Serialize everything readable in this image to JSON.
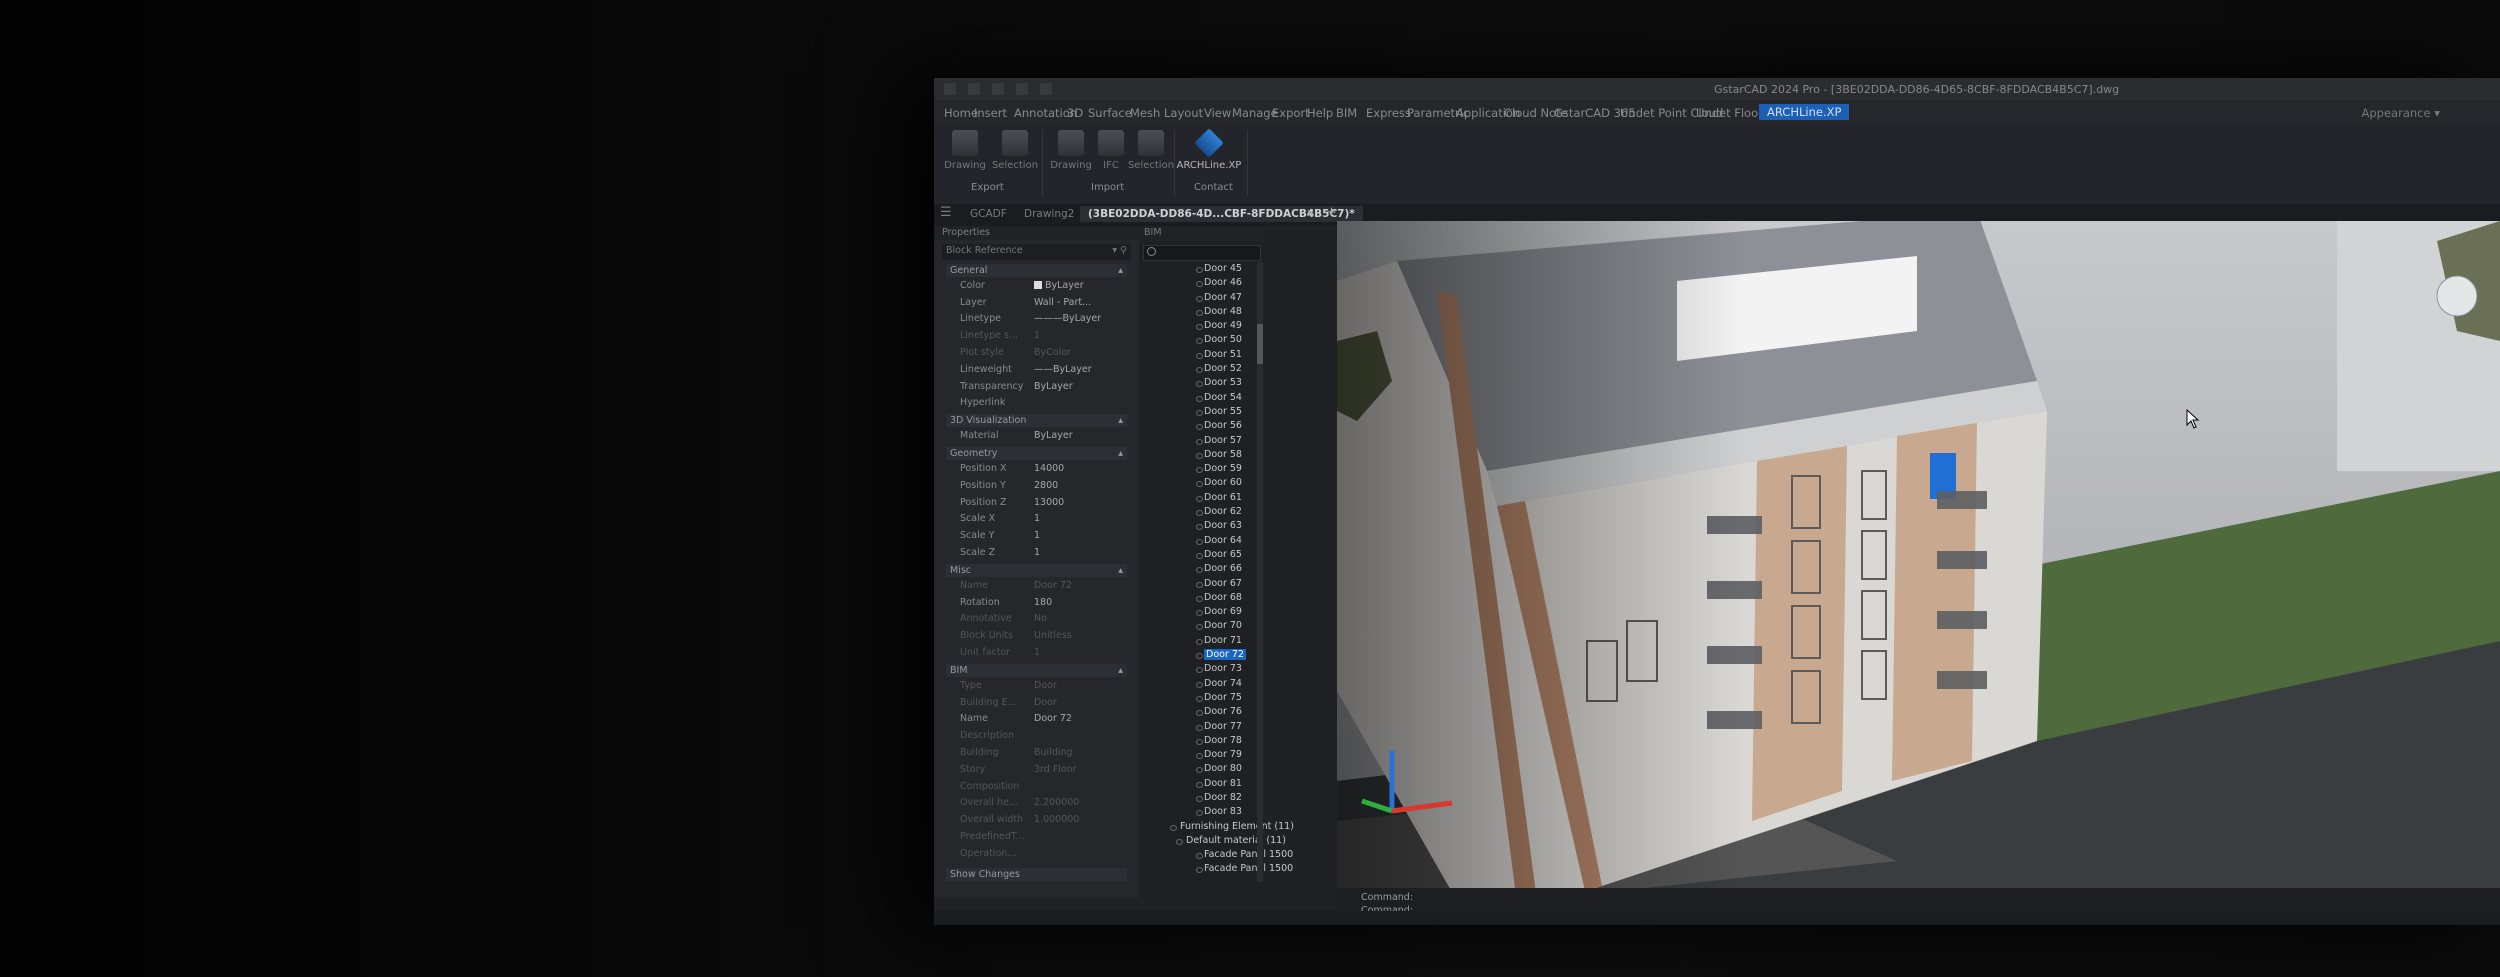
{
  "window": {
    "title": "GstarCAD 2024 Pro - [3BE02DDA-DD86-4D65-8CBF-8FDDACB4B5C7].dwg"
  },
  "menu": {
    "items": [
      "Home",
      "Insert",
      "Annotation",
      "3D",
      "Surface",
      "Mesh",
      "Layout",
      "View",
      "Manage",
      "Export",
      "Help",
      "BIM",
      "Express",
      "Parametric",
      "Application",
      "Cloud Note",
      "GstarCAD 365",
      "Undet Point Cloud",
      "Undet Floor Plan",
      "ARCHLine.XP"
    ],
    "active": "ARCHLine.XP",
    "workspace": "Appearance ▾"
  },
  "ribbon": {
    "buttons": [
      {
        "label": "Drawing"
      },
      {
        "label": "Selection"
      },
      {
        "label": "Drawing"
      },
      {
        "label": "IFC"
      },
      {
        "label": "Selection"
      },
      {
        "label": "ARCHLine.XP"
      }
    ],
    "groups": [
      "Export",
      "Import",
      "Contact"
    ]
  },
  "tabs": [
    "GCADF",
    "Drawing2",
    "(3BE02DDA-DD86-4D...CBF-8FDDACB4B5C7)*"
  ],
  "properties": {
    "header": "Properties",
    "selector": "Block Reference",
    "sections": [
      {
        "title": "General",
        "rows": [
          {
            "k": "Color",
            "v": "ByLayer",
            "swatch": true
          },
          {
            "k": "Layer",
            "v": "Wall - Part..."
          },
          {
            "k": "Linetype",
            "v": "———ByLayer"
          },
          {
            "k": "Linetype s...",
            "v": "1",
            "dim": true
          },
          {
            "k": "Plot style",
            "v": "ByColor",
            "dim": true
          },
          {
            "k": "Lineweight",
            "v": "——ByLayer"
          },
          {
            "k": "Transparency",
            "v": "ByLayer"
          },
          {
            "k": "Hyperlink",
            "v": ""
          }
        ]
      },
      {
        "title": "3D Visualization",
        "rows": [
          {
            "k": "Material",
            "v": "ByLayer"
          }
        ]
      },
      {
        "title": "Geometry",
        "rows": [
          {
            "k": "Position X",
            "v": "14000"
          },
          {
            "k": "Position Y",
            "v": "2800"
          },
          {
            "k": "Position Z",
            "v": "13000"
          },
          {
            "k": "Scale X",
            "v": "1"
          },
          {
            "k": "Scale Y",
            "v": "1"
          },
          {
            "k": "Scale Z",
            "v": "1"
          }
        ]
      },
      {
        "title": "Misc",
        "rows": [
          {
            "k": "Name",
            "v": "Door 72",
            "dim": true
          },
          {
            "k": "Rotation",
            "v": "180"
          },
          {
            "k": "Annotative",
            "v": "No",
            "dim": true
          },
          {
            "k": "Block Units",
            "v": "Unitless",
            "dim": true
          },
          {
            "k": "Unit factor",
            "v": "1",
            "dim": true
          }
        ]
      },
      {
        "title": "BIM",
        "rows": [
          {
            "k": "Type",
            "v": "Door",
            "dim": true
          },
          {
            "k": "Building E...",
            "v": "Door",
            "dim": true
          },
          {
            "k": "Name",
            "v": "Door 72"
          },
          {
            "k": "Description",
            "v": "",
            "dim": true
          },
          {
            "k": "Building",
            "v": "Building",
            "dim": true
          },
          {
            "k": "Story",
            "v": "3rd Floor",
            "dim": true
          },
          {
            "k": "Composition",
            "v": "",
            "dim": true
          },
          {
            "k": "Overall he...",
            "v": "2.200000",
            "dim": true
          },
          {
            "k": "Overall width",
            "v": "1.000000",
            "dim": true
          },
          {
            "k": "PredefinedT...",
            "v": "",
            "dim": true
          },
          {
            "k": "Operation...",
            "v": "",
            "dim": true
          }
        ]
      }
    ],
    "footer": "Show Changes"
  },
  "tree": {
    "header": "BIM",
    "items": [
      {
        "label": "Door 45",
        "level": 3
      },
      {
        "label": "Door 46",
        "level": 3
      },
      {
        "label": "Door 47",
        "level": 3
      },
      {
        "label": "Door 48",
        "level": 3
      },
      {
        "label": "Door 49",
        "level": 3
      },
      {
        "label": "Door 50",
        "level": 3
      },
      {
        "label": "Door 51",
        "level": 3
      },
      {
        "label": "Door 52",
        "level": 3
      },
      {
        "label": "Door 53",
        "level": 3
      },
      {
        "label": "Door 54",
        "level": 3
      },
      {
        "label": "Door 55",
        "level": 3
      },
      {
        "label": "Door 56",
        "level": 3
      },
      {
        "label": "Door 57",
        "level": 3
      },
      {
        "label": "Door 58",
        "level": 3
      },
      {
        "label": "Door 59",
        "level": 3
      },
      {
        "label": "Door 60",
        "level": 3
      },
      {
        "label": "Door 61",
        "level": 3
      },
      {
        "label": "Door 62",
        "level": 3
      },
      {
        "label": "Door 63",
        "level": 3
      },
      {
        "label": "Door 64",
        "level": 3
      },
      {
        "label": "Door 65",
        "level": 3
      },
      {
        "label": "Door 66",
        "level": 3
      },
      {
        "label": "Door 67",
        "level": 3
      },
      {
        "label": "Door 68",
        "level": 3
      },
      {
        "label": "Door 69",
        "level": 3
      },
      {
        "label": "Door 70",
        "level": 3
      },
      {
        "label": "Door 71",
        "level": 3
      },
      {
        "label": "Door 72",
        "level": 3,
        "selected": true
      },
      {
        "label": "Door 73",
        "level": 3
      },
      {
        "label": "Door 74",
        "level": 3
      },
      {
        "label": "Door 75",
        "level": 3
      },
      {
        "label": "Door 76",
        "level": 3
      },
      {
        "label": "Door 77",
        "level": 3
      },
      {
        "label": "Door 78",
        "level": 3
      },
      {
        "label": "Door 79",
        "level": 3
      },
      {
        "label": "Door 80",
        "level": 3
      },
      {
        "label": "Door 81",
        "level": 3
      },
      {
        "label": "Door 82",
        "level": 3
      },
      {
        "label": "Door 83",
        "level": 3
      },
      {
        "label": "Furnishing Element (11)",
        "level": 1
      },
      {
        "label": "Default material (11)",
        "level": 2
      },
      {
        "label": "Facade Panel 1500",
        "level": 3
      },
      {
        "label": "Facade Panel 1500",
        "level": 3
      }
    ]
  },
  "command": {
    "line1": "Command:",
    "line2": "Command:"
  },
  "colors": {
    "selection": "#1a66c4",
    "accent_tab": "#1d5fb4"
  }
}
